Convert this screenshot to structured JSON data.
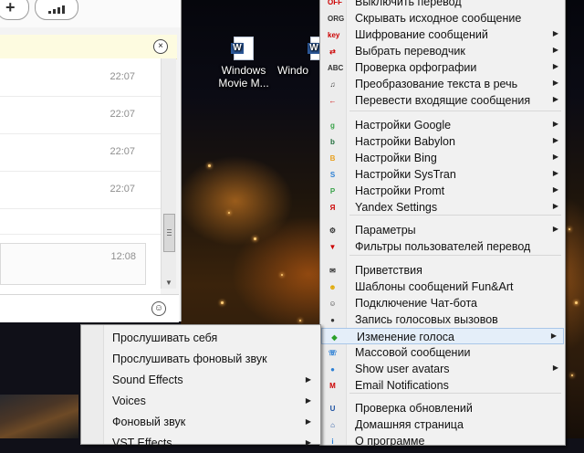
{
  "desktop": {
    "icons": [
      {
        "label_line1": "Windows",
        "label_line2": "Movie M..."
      },
      {
        "label_line1": "Windo",
        "label_line2": ""
      }
    ]
  },
  "chat": {
    "timestamps": [
      "22:07",
      "22:07",
      "22:07",
      "22:07"
    ],
    "last_message_time": "12:08",
    "close_symbol": "×",
    "add_symbol": "+",
    "emoji_symbol": "☺"
  },
  "main_menu": {
    "items": [
      {
        "label": "Выключить перевод",
        "icon": "OFF",
        "color": "#cc0000",
        "arrow": false
      },
      {
        "label": "Скрывать исходное сообщение",
        "icon": "ORG",
        "color": "#333333",
        "arrow": false
      },
      {
        "label": "Шифрование сообщений",
        "icon": "key",
        "color": "#cc0000",
        "arrow": true
      },
      {
        "label": "Выбрать переводчик",
        "icon": "⇄",
        "color": "#cc0000",
        "arrow": true
      },
      {
        "label": "Проверка орфографии",
        "icon": "ABC",
        "color": "#333333",
        "arrow": true
      },
      {
        "label": "Преобразование текста в речь",
        "icon": "♫",
        "color": "#333333",
        "arrow": true
      },
      {
        "label": "Перевести входящие сообщения",
        "icon": "←",
        "color": "#cc0000",
        "arrow": true
      },
      {
        "label": "Настройки Google",
        "icon": "g",
        "color": "#3aa34a",
        "arrow": true
      },
      {
        "label": "Настройки Babylon",
        "icon": "b",
        "color": "#1f6d3a",
        "arrow": true
      },
      {
        "label": "Настройки Bing",
        "icon": "B",
        "color": "#e8a020",
        "arrow": true
      },
      {
        "label": "Настройки SysTran",
        "icon": "S",
        "color": "#2b7fd4",
        "arrow": true
      },
      {
        "label": "Настройки Promt",
        "icon": "P",
        "color": "#3aa34a",
        "arrow": true
      },
      {
        "label": "Yandex Settings",
        "icon": "Я",
        "color": "#cc0000",
        "arrow": true
      },
      {
        "label": "Параметры",
        "icon": "⚙",
        "color": "#333333",
        "arrow": true
      },
      {
        "label": "Фильтры пользователей перевод",
        "icon": "▼",
        "color": "#cc0000",
        "arrow": false
      },
      {
        "label": "Приветствия",
        "icon": "✉",
        "color": "#333333",
        "arrow": false
      },
      {
        "label": "Шаблоны сообщений Fun&Art",
        "icon": "☻",
        "color": "#e0a800",
        "arrow": false
      },
      {
        "label": "Подключение Чат-бота",
        "icon": "☺",
        "color": "#333333",
        "arrow": false
      },
      {
        "label": "Запись голосовых вызовов",
        "icon": "●",
        "color": "#333333",
        "arrow": false
      },
      {
        "label": "Изменение голоса",
        "icon": "◆",
        "color": "#2aa02a",
        "arrow": true
      },
      {
        "label": "Массовой сообщении",
        "icon": "☏",
        "color": "#2b7fd4",
        "arrow": false
      },
      {
        "label": "Show user avatars",
        "icon": "●",
        "color": "#2b7fd4",
        "arrow": true
      },
      {
        "label": "Email Notifications",
        "icon": "M",
        "color": "#cc0000",
        "arrow": false
      },
      {
        "label": "Проверка обновлений",
        "icon": "U",
        "color": "#1a4fa0",
        "arrow": false
      },
      {
        "label": "Домашняя страница",
        "icon": "⌂",
        "color": "#1a4fa0",
        "arrow": false
      },
      {
        "label": "О программе",
        "icon": "i",
        "color": "#2b7fd4",
        "arrow": false
      }
    ]
  },
  "sub_menu": {
    "items": [
      {
        "label": "Прослушивать себя",
        "arrow": false
      },
      {
        "label": "Прослушивать фоновый звук",
        "arrow": false
      },
      {
        "label": "Sound Effects",
        "arrow": true
      },
      {
        "label": "Voices",
        "arrow": true
      },
      {
        "label": "Фоновый звук",
        "arrow": true
      },
      {
        "label": "VST Effects",
        "arrow": true
      }
    ]
  },
  "arrow_glyph": "▶"
}
